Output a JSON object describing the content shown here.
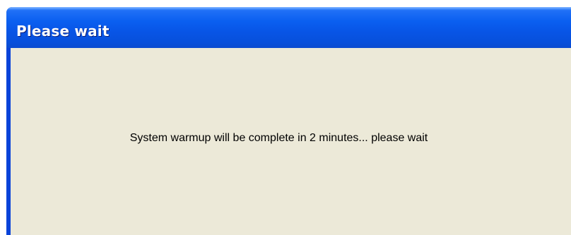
{
  "window": {
    "title": "Please wait",
    "message": "System warmup will be complete in 2 minutes... please wait"
  },
  "colors": {
    "titlebar": "#0855e6",
    "frame": "#0843d9",
    "client_background": "#ece9d8",
    "title_text": "#ffffff",
    "message_text": "#000000"
  }
}
